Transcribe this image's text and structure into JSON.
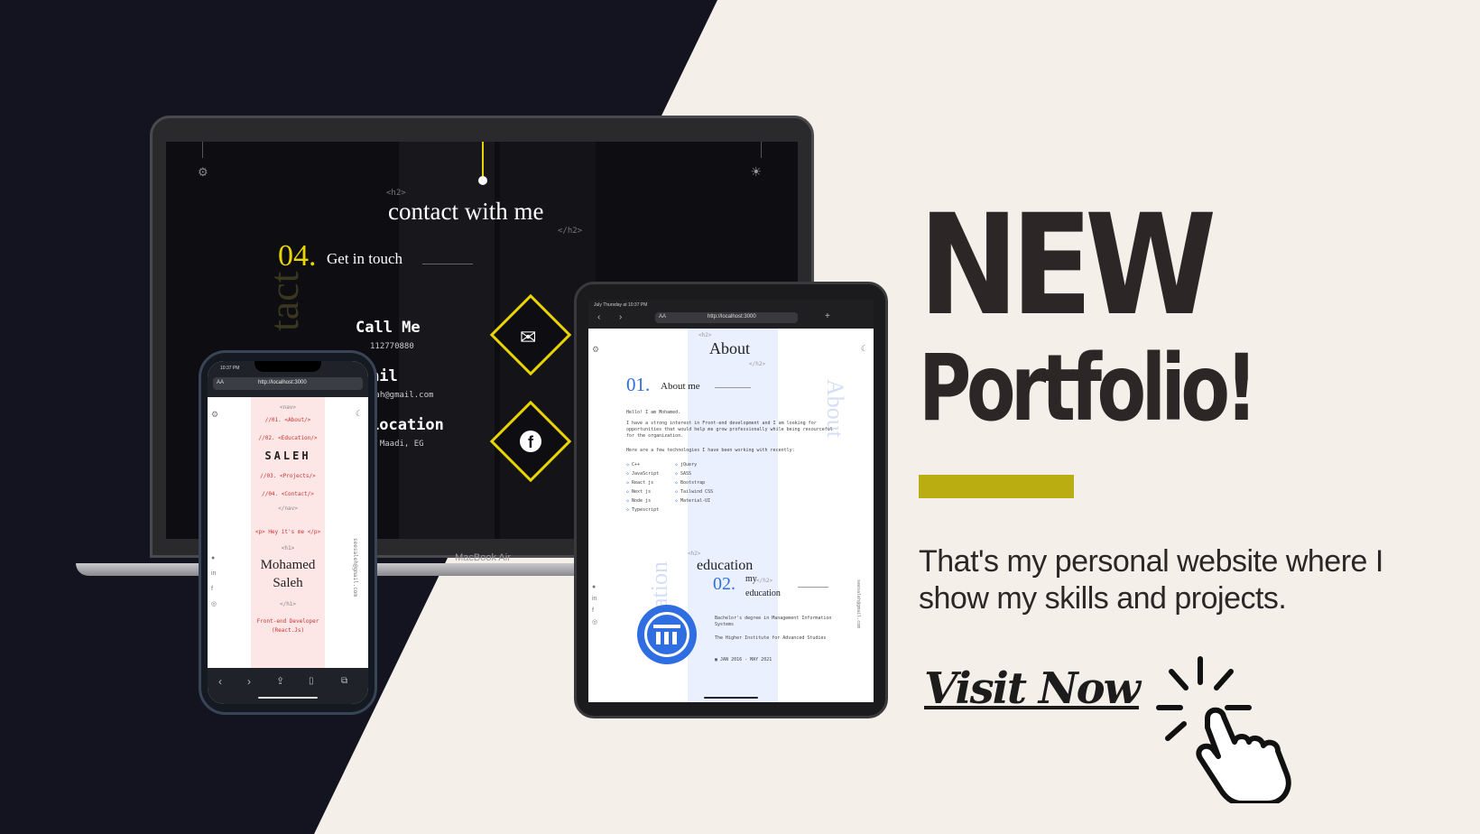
{
  "laptop": {
    "h2_open": "<h2>",
    "title": "contact with me",
    "h2_close": "</h2>",
    "section_number": "04.",
    "section_label": "Get in touch",
    "side_word": "tact",
    "call_label": "Call Me",
    "call_value": "112770880",
    "email_label": "ail",
    "email_value": "lah@gmail.com",
    "location_label": "Location",
    "location_value": ", Maadi, EG",
    "brand": "MacBook Air"
  },
  "phone": {
    "time": "10:37 PM",
    "url": "http://localhost:3000",
    "aa": "AA",
    "nav_open": "<nav>",
    "nav_items": [
      "//01. <About/>",
      "//02. <Education/>",
      "//03. <Projects/>",
      "//04. <Contact/>"
    ],
    "logo": "SALEH",
    "nav_close": "</nav>",
    "greeting": "<p> Hey it's me </p>",
    "h1_open": "<h1>",
    "name_line1": "Mohamed",
    "name_line2": "Saleh",
    "h1_close": "</h1>",
    "role": "Front-end Developer (React.Js)",
    "email_side": "seesaleh@gmail.com"
  },
  "tablet": {
    "status_left": "July Thursday at 10:37 PM",
    "url": "http://localhost:3000",
    "aa": "AA",
    "h2_open": "<h2>",
    "about_title": "About",
    "h2_close": "</h2>",
    "about_num": "01.",
    "about_label": "About me",
    "about_side": "About",
    "intro": "Hello! I am Mohamed.",
    "para": "I have a strong interest in Front-end development and I am looking for opportunities that would help me grow professionally while being resourceful for the organization.",
    "tech_intro": "Here are a few technologies I have been working with recently:",
    "tech_col1": [
      "C++",
      "JavaScript",
      "React js",
      "Next js",
      "Node js",
      "Typescript"
    ],
    "tech_col2": [
      "jQuery",
      "SASS",
      "Bootstrap",
      "Tailwind CSS",
      "Material-UI"
    ],
    "edu_title": "education",
    "edu_num": "02.",
    "edu_label_line1": "my",
    "edu_label_line2": "education",
    "edu_side": "Education",
    "degree": "Bachelor's degree in Management Information Systems",
    "institute": "The Higher Institute for Advanced Studies",
    "dates": "JAN 2016 - MAY 2021",
    "email_side": "seesaleh@gmail.com"
  },
  "promo": {
    "headline_1": "NEW",
    "headline_2": "Portfolio!",
    "tagline": "That's my personal website where I show my skills and projects.",
    "cta": "Visit Now",
    "accent_color": "#b9ad12"
  }
}
